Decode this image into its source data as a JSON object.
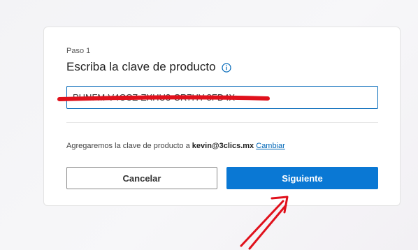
{
  "dialog": {
    "step_label": "Paso 1",
    "title": "Escriba la clave de producto",
    "product_key_value": "PHNFM-V4CCZ-ZXHU3-CR7HY-8FD4X",
    "account_text_prefix": "Agregaremos la clave de producto a",
    "account_email": "kevin@3clics.mx",
    "change_link": "Cambiar",
    "cancel_label": "Cancelar",
    "next_label": "Siguiente"
  },
  "colors": {
    "accent": "#0a78d4",
    "annotation": "#e0111c"
  },
  "icons": {
    "info": "info-circle-icon"
  }
}
